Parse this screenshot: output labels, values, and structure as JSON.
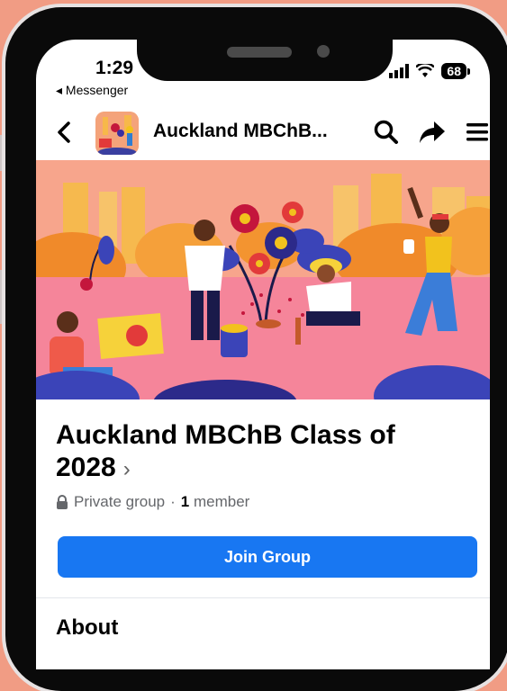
{
  "status_bar": {
    "time": "1:29",
    "back_app": "Messenger",
    "battery": "68"
  },
  "nav": {
    "title": "Auckland MBChB..."
  },
  "group": {
    "name": "Auckland MBChB Class of 2028",
    "privacy": "Private group",
    "member_count": "1",
    "member_label": "member",
    "separator": "·"
  },
  "actions": {
    "join_label": "Join Group"
  },
  "sections": {
    "about_title": "About"
  },
  "colors": {
    "accent": "#1877f2",
    "background": "#f19c84",
    "cover_bg": "#f7a58c"
  },
  "icons": [
    "back-chevron-icon",
    "search-icon",
    "share-icon",
    "menu-icon",
    "lock-icon",
    "chevron-right-icon"
  ]
}
